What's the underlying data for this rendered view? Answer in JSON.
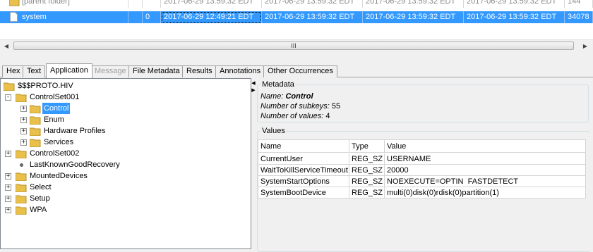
{
  "files": {
    "rows": [
      {
        "name": "[parent folder]",
        "c2": "",
        "c3": "",
        "modified": "2017-06-29 13:59:32 EDT",
        "changed": "2017-06-29 13:59:32 EDT",
        "accessed": "2017-06-29 13:59:32 EDT",
        "created": "2017-06-29 13:59:32 EDT",
        "size": "144"
      },
      {
        "name": "system",
        "c2": "",
        "c3": "0",
        "modified": "2017-06-29 12:49:21 EDT",
        "changed": "2017-06-29 13:59:32 EDT",
        "accessed": "2017-06-29 13:59:32 EDT",
        "created": "2017-06-29 13:59:32 EDT",
        "size": "34078"
      }
    ],
    "scroll_thumb_glyph": "III"
  },
  "tabs": [
    {
      "label": "Hex",
      "state": "normal"
    },
    {
      "label": "Text",
      "state": "normal"
    },
    {
      "label": "Application",
      "state": "active"
    },
    {
      "label": "Message",
      "state": "disabled"
    },
    {
      "label": "File Metadata",
      "state": "normal"
    },
    {
      "label": "Results",
      "state": "normal"
    },
    {
      "label": "Annotations",
      "state": "normal"
    },
    {
      "label": "Other Occurrences",
      "state": "normal"
    }
  ],
  "tree": {
    "root": "$$$PROTO.HIV",
    "controlset001": "ControlSet001",
    "control": "Control",
    "enum": "Enum",
    "hardware_profiles": "Hardware Profiles",
    "services": "Services",
    "controlset002": "ControlSet002",
    "last_known_good": "LastKnownGoodRecovery",
    "mounted_devices": "MountedDevices",
    "select": "Select",
    "setup": "Setup",
    "wpa": "WPA",
    "expand_glyph": "+",
    "collapse_glyph": "-"
  },
  "metadata": {
    "title": "Metadata",
    "name_label": "Name:",
    "name_value": "Control",
    "subkeys_label": "Number of subkeys:",
    "subkeys_value": "55",
    "values_label": "Number of values:",
    "values_value": "4"
  },
  "values": {
    "title": "Values",
    "headers": [
      "Name",
      "Type",
      "Value"
    ],
    "rows": [
      {
        "name": "CurrentUser",
        "type": "REG_SZ",
        "value": "USERNAME"
      },
      {
        "name": "WaitToKillServiceTimeout",
        "type": "REG_SZ",
        "value": "20000"
      },
      {
        "name": "SystemStartOptions",
        "type": "REG_SZ",
        "value": "NOEXECUTE=OPTIN  FASTDETECT"
      },
      {
        "name": "SystemBootDevice",
        "type": "REG_SZ",
        "value": "multi(0)disk(0)rdisk(0)partition(1)"
      }
    ]
  },
  "colors": {
    "selection": "#3399ff",
    "folder": "#e8c04a"
  }
}
